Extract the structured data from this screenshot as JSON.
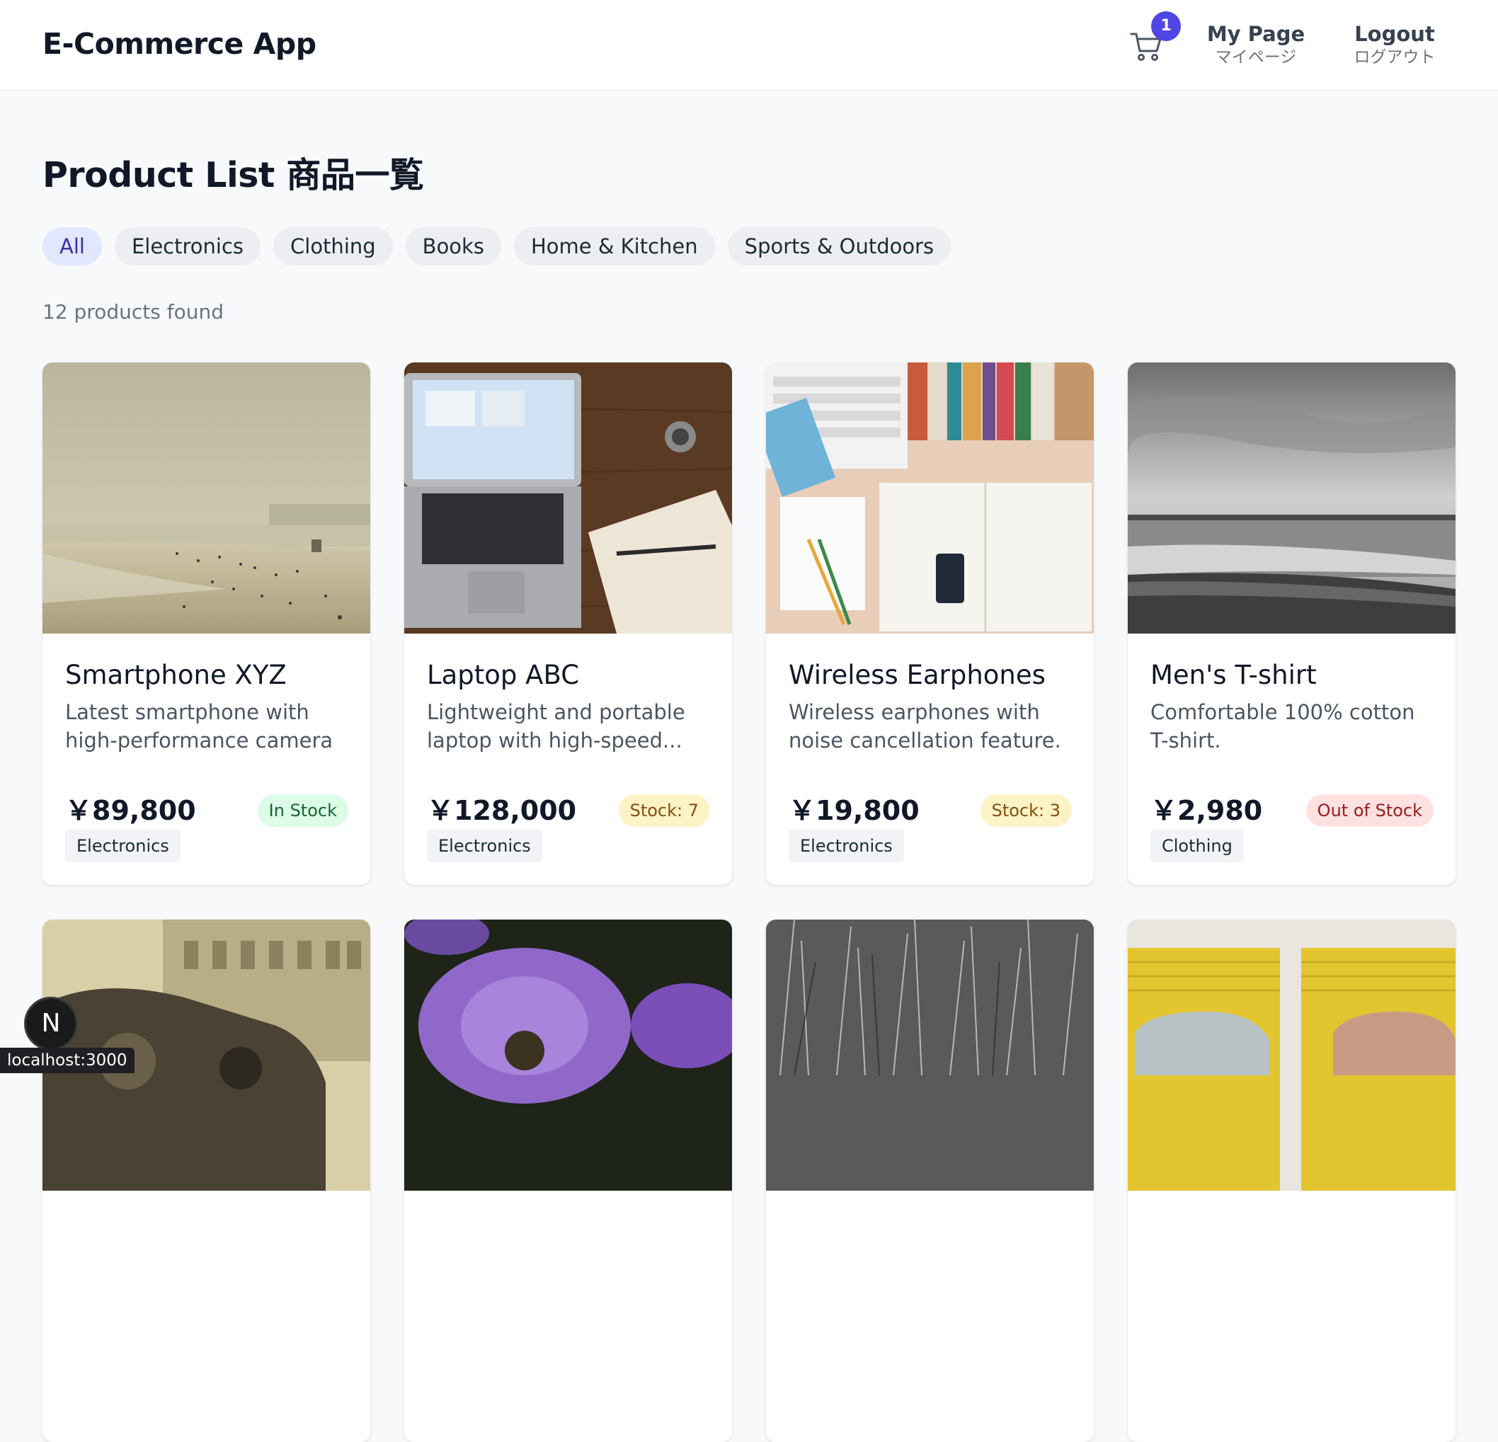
{
  "header": {
    "brand": "E-Commerce App",
    "cart_count": "1",
    "cart_icon": "cart-icon",
    "my_page": {
      "en": "My Page",
      "ja": "マイページ"
    },
    "logout": {
      "en": "Logout",
      "ja": "ログアウト"
    }
  },
  "page": {
    "title": "Product List 商品一覧",
    "count_text": "12 products found"
  },
  "filters": [
    "All",
    "Electronics",
    "Clothing",
    "Books",
    "Home & Kitchen",
    "Sports & Outdoors"
  ],
  "active_filter": "All",
  "products": [
    {
      "name": "Smartphone XYZ",
      "desc": "Latest smartphone with high-performance camera and...",
      "price": "￥89,800",
      "stock": "In Stock",
      "stock_state": "in",
      "category": "Electronics"
    },
    {
      "name": "Laptop ABC",
      "desc": "Lightweight and portable laptop with high-speed...",
      "price": "￥128,000",
      "stock": "Stock: 7",
      "stock_state": "low",
      "category": "Electronics"
    },
    {
      "name": "Wireless Earphones",
      "desc": "Wireless earphones with noise cancellation feature.",
      "price": "￥19,800",
      "stock": "Stock: 3",
      "stock_state": "low",
      "category": "Electronics"
    },
    {
      "name": "Men's T-shirt",
      "desc": "Comfortable 100% cotton T-shirt.",
      "price": "￥2,980",
      "stock": "Out of Stock",
      "stock_state": "out",
      "category": "Clothing"
    }
  ],
  "dev": {
    "logo_letter": "N",
    "status_url": "localhost:3000"
  },
  "colors": {
    "accent": "#4f46e5",
    "chip_active_bg": "#e0e7ff",
    "chip_active_text": "#3730a3",
    "in_stock": "#166534",
    "low_stock": "#854d0e",
    "out_stock": "#991b1b"
  }
}
